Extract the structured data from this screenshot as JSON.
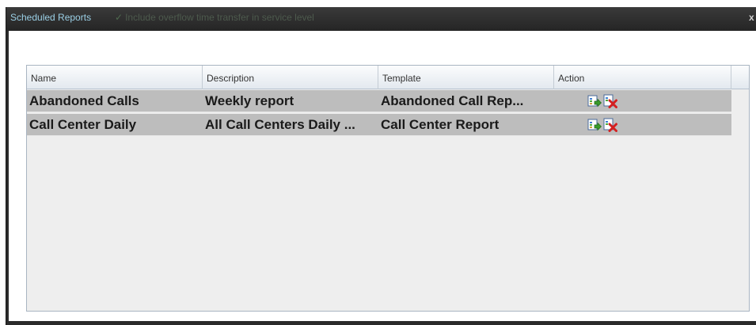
{
  "dialog": {
    "title": "Scheduled Reports",
    "ghost_text": "Include overflow time transfer in service level",
    "ghost_check": "✓",
    "close_label": "x"
  },
  "grid": {
    "columns": [
      "Name",
      "Description",
      "Template",
      "Action"
    ],
    "rows": [
      {
        "name": "Abandoned Calls",
        "description": "Weekly report",
        "template": "Abandoned Call Rep...",
        "actions": [
          "run-report-icon",
          "delete-report-icon"
        ]
      },
      {
        "name": "Call Center Daily",
        "description": "All Call Centers Daily ...",
        "template": "Call Center Report",
        "actions": [
          "run-report-icon",
          "delete-report-icon"
        ]
      }
    ]
  },
  "colors": {
    "titlebar": "#2b2b2b",
    "title_text": "#9bd0e6",
    "row_background": "#bdbdbd",
    "grid_background": "#eeeeee"
  }
}
